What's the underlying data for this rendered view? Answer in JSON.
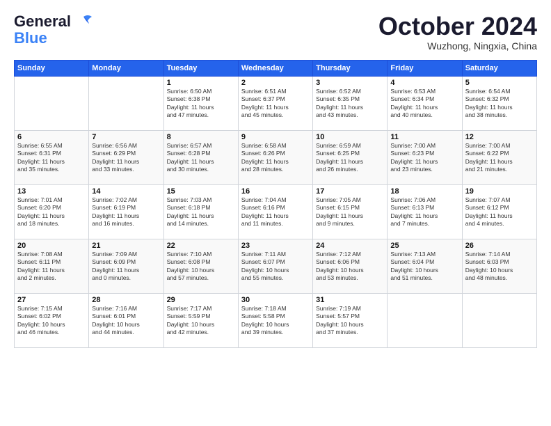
{
  "header": {
    "logo_general": "General",
    "logo_blue": "Blue",
    "month_title": "October 2024",
    "location": "Wuzhong, Ningxia, China"
  },
  "weekdays": [
    "Sunday",
    "Monday",
    "Tuesday",
    "Wednesday",
    "Thursday",
    "Friday",
    "Saturday"
  ],
  "weeks": [
    [
      {
        "day": "",
        "info": ""
      },
      {
        "day": "",
        "info": ""
      },
      {
        "day": "1",
        "info": "Sunrise: 6:50 AM\nSunset: 6:38 PM\nDaylight: 11 hours\nand 47 minutes."
      },
      {
        "day": "2",
        "info": "Sunrise: 6:51 AM\nSunset: 6:37 PM\nDaylight: 11 hours\nand 45 minutes."
      },
      {
        "day": "3",
        "info": "Sunrise: 6:52 AM\nSunset: 6:35 PM\nDaylight: 11 hours\nand 43 minutes."
      },
      {
        "day": "4",
        "info": "Sunrise: 6:53 AM\nSunset: 6:34 PM\nDaylight: 11 hours\nand 40 minutes."
      },
      {
        "day": "5",
        "info": "Sunrise: 6:54 AM\nSunset: 6:32 PM\nDaylight: 11 hours\nand 38 minutes."
      }
    ],
    [
      {
        "day": "6",
        "info": "Sunrise: 6:55 AM\nSunset: 6:31 PM\nDaylight: 11 hours\nand 35 minutes."
      },
      {
        "day": "7",
        "info": "Sunrise: 6:56 AM\nSunset: 6:29 PM\nDaylight: 11 hours\nand 33 minutes."
      },
      {
        "day": "8",
        "info": "Sunrise: 6:57 AM\nSunset: 6:28 PM\nDaylight: 11 hours\nand 30 minutes."
      },
      {
        "day": "9",
        "info": "Sunrise: 6:58 AM\nSunset: 6:26 PM\nDaylight: 11 hours\nand 28 minutes."
      },
      {
        "day": "10",
        "info": "Sunrise: 6:59 AM\nSunset: 6:25 PM\nDaylight: 11 hours\nand 26 minutes."
      },
      {
        "day": "11",
        "info": "Sunrise: 7:00 AM\nSunset: 6:23 PM\nDaylight: 11 hours\nand 23 minutes."
      },
      {
        "day": "12",
        "info": "Sunrise: 7:00 AM\nSunset: 6:22 PM\nDaylight: 11 hours\nand 21 minutes."
      }
    ],
    [
      {
        "day": "13",
        "info": "Sunrise: 7:01 AM\nSunset: 6:20 PM\nDaylight: 11 hours\nand 18 minutes."
      },
      {
        "day": "14",
        "info": "Sunrise: 7:02 AM\nSunset: 6:19 PM\nDaylight: 11 hours\nand 16 minutes."
      },
      {
        "day": "15",
        "info": "Sunrise: 7:03 AM\nSunset: 6:18 PM\nDaylight: 11 hours\nand 14 minutes."
      },
      {
        "day": "16",
        "info": "Sunrise: 7:04 AM\nSunset: 6:16 PM\nDaylight: 11 hours\nand 11 minutes."
      },
      {
        "day": "17",
        "info": "Sunrise: 7:05 AM\nSunset: 6:15 PM\nDaylight: 11 hours\nand 9 minutes."
      },
      {
        "day": "18",
        "info": "Sunrise: 7:06 AM\nSunset: 6:13 PM\nDaylight: 11 hours\nand 7 minutes."
      },
      {
        "day": "19",
        "info": "Sunrise: 7:07 AM\nSunset: 6:12 PM\nDaylight: 11 hours\nand 4 minutes."
      }
    ],
    [
      {
        "day": "20",
        "info": "Sunrise: 7:08 AM\nSunset: 6:11 PM\nDaylight: 11 hours\nand 2 minutes."
      },
      {
        "day": "21",
        "info": "Sunrise: 7:09 AM\nSunset: 6:09 PM\nDaylight: 11 hours\nand 0 minutes."
      },
      {
        "day": "22",
        "info": "Sunrise: 7:10 AM\nSunset: 6:08 PM\nDaylight: 10 hours\nand 57 minutes."
      },
      {
        "day": "23",
        "info": "Sunrise: 7:11 AM\nSunset: 6:07 PM\nDaylight: 10 hours\nand 55 minutes."
      },
      {
        "day": "24",
        "info": "Sunrise: 7:12 AM\nSunset: 6:06 PM\nDaylight: 10 hours\nand 53 minutes."
      },
      {
        "day": "25",
        "info": "Sunrise: 7:13 AM\nSunset: 6:04 PM\nDaylight: 10 hours\nand 51 minutes."
      },
      {
        "day": "26",
        "info": "Sunrise: 7:14 AM\nSunset: 6:03 PM\nDaylight: 10 hours\nand 48 minutes."
      }
    ],
    [
      {
        "day": "27",
        "info": "Sunrise: 7:15 AM\nSunset: 6:02 PM\nDaylight: 10 hours\nand 46 minutes."
      },
      {
        "day": "28",
        "info": "Sunrise: 7:16 AM\nSunset: 6:01 PM\nDaylight: 10 hours\nand 44 minutes."
      },
      {
        "day": "29",
        "info": "Sunrise: 7:17 AM\nSunset: 5:59 PM\nDaylight: 10 hours\nand 42 minutes."
      },
      {
        "day": "30",
        "info": "Sunrise: 7:18 AM\nSunset: 5:58 PM\nDaylight: 10 hours\nand 39 minutes."
      },
      {
        "day": "31",
        "info": "Sunrise: 7:19 AM\nSunset: 5:57 PM\nDaylight: 10 hours\nand 37 minutes."
      },
      {
        "day": "",
        "info": ""
      },
      {
        "day": "",
        "info": ""
      }
    ]
  ]
}
